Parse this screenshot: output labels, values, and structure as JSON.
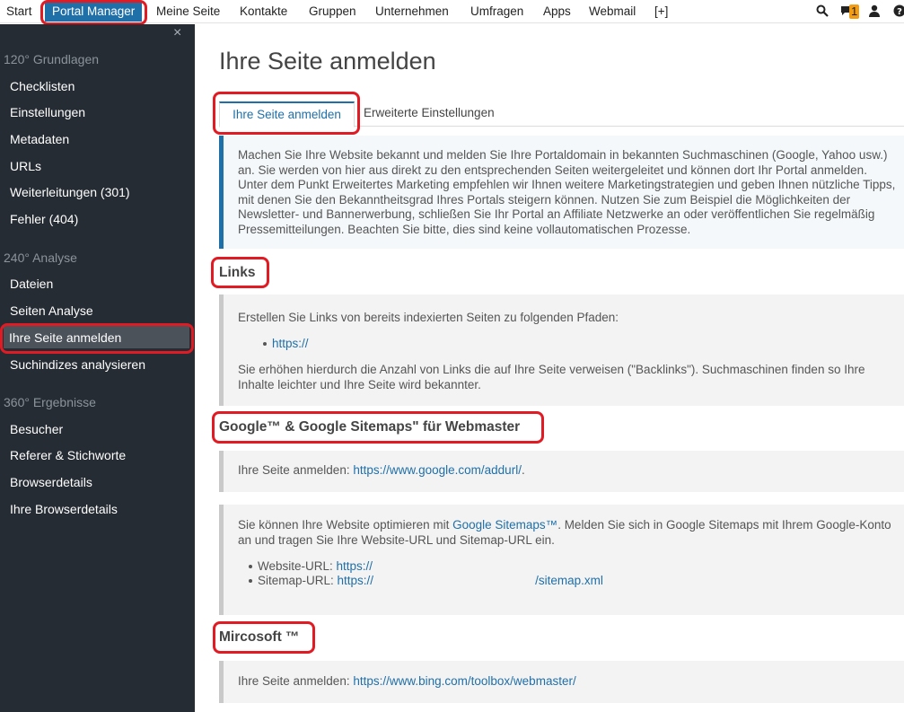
{
  "nav": {
    "items": [
      "Start",
      "Portal Manager",
      "Meine Seite",
      "Kontakte",
      "Gruppen",
      "Unternehmen",
      "Umfragen",
      "Apps",
      "Webmail",
      "[+]"
    ],
    "notification_count": "1",
    "icons": [
      "search-icon",
      "chat-icon",
      "user-icon",
      "help-icon"
    ]
  },
  "sidebar": {
    "sections": [
      {
        "title": "120° Grundlagen",
        "items": [
          "Checklisten",
          "Einstellungen",
          "Metadaten",
          "URLs",
          "Weiterleitungen (301)",
          "Fehler (404)"
        ]
      },
      {
        "title": "240° Analyse",
        "items": [
          "Dateien",
          "Seiten Analyse",
          "Ihre Seite anmelden",
          "Suchindizes analysieren"
        ]
      },
      {
        "title": "360° Ergebnisse",
        "items": [
          "Besucher",
          "Referer & Stichworte",
          "Browserdetails",
          "Ihre Browserdetails"
        ]
      }
    ],
    "active_item": "Ihre Seite anmelden",
    "close_label": "×"
  },
  "main": {
    "title": "Ihre Seite anmelden",
    "tabs": [
      "Ihre Seite anmelden",
      "Erweiterte Einstellungen"
    ],
    "intro": "Machen Sie Ihre Website bekannt und melden Sie Ihre Portaldomain in bekannten Suchmaschinen (Google, Yahoo usw.) an. Sie werden von hier aus direkt zu den entsprechenden Seiten weitergeleitet und können dort Ihr Portal anmelden. Unter dem Punkt Erweitertes Marketing empfehlen wir Ihnen weitere Marketingstrategien und geben Ihnen nützliche Tipps, mit denen Sie den Bekanntheitsgrad Ihres Portals steigern können. Nutzen Sie zum Beispiel die Möglichkeiten der Newsletter- und Bannerwerbung, schließen Sie Ihr Portal an Affiliate Netzwerke an oder veröffentlichen Sie regelmäßig Pressemitteilungen. Beachten Sie bitte, dies sind keine vollautomatischen Prozesse.",
    "links": {
      "heading": "Links",
      "text1": "Erstellen Sie Links von bereits indexierten Seiten zu folgenden Pfaden:",
      "url": "https://",
      "text2": "Sie erhöhen hierdurch die Anzahl von Links die auf Ihre Seite verweisen (\"Backlinks\"). Suchmaschinen finden so Ihre Inhalte leichter und Ihre Seite wird bekannter."
    },
    "google": {
      "heading": "Google™ & Google Sitemaps\" für Webmaster",
      "submit_prefix": "Ihre Seite anmelden: ",
      "submit_url": "https://www.google.com/addurl/",
      "submit_suffix": ".",
      "sitemaps_prefix": "Sie können Ihre Website optimieren mit ",
      "sitemaps_link": "Google Sitemaps™",
      "sitemaps_suffix": ". Melden Sie sich in Google Sitemaps mit Ihrem Google-Konto an und tragen Sie Ihre Website-URL und Sitemap-URL ein.",
      "website_label": "Website-URL: ",
      "website_url": "https://",
      "sitemap_label": "Sitemap-URL: ",
      "sitemap_url_start": "https://",
      "sitemap_url_end": "/sitemap.xml"
    },
    "microsoft": {
      "heading": "Mircosoft ™",
      "submit_prefix": "Ihre Seite anmelden: ",
      "submit_url": "https://www.bing.com/toolbox/webmaster/"
    }
  }
}
